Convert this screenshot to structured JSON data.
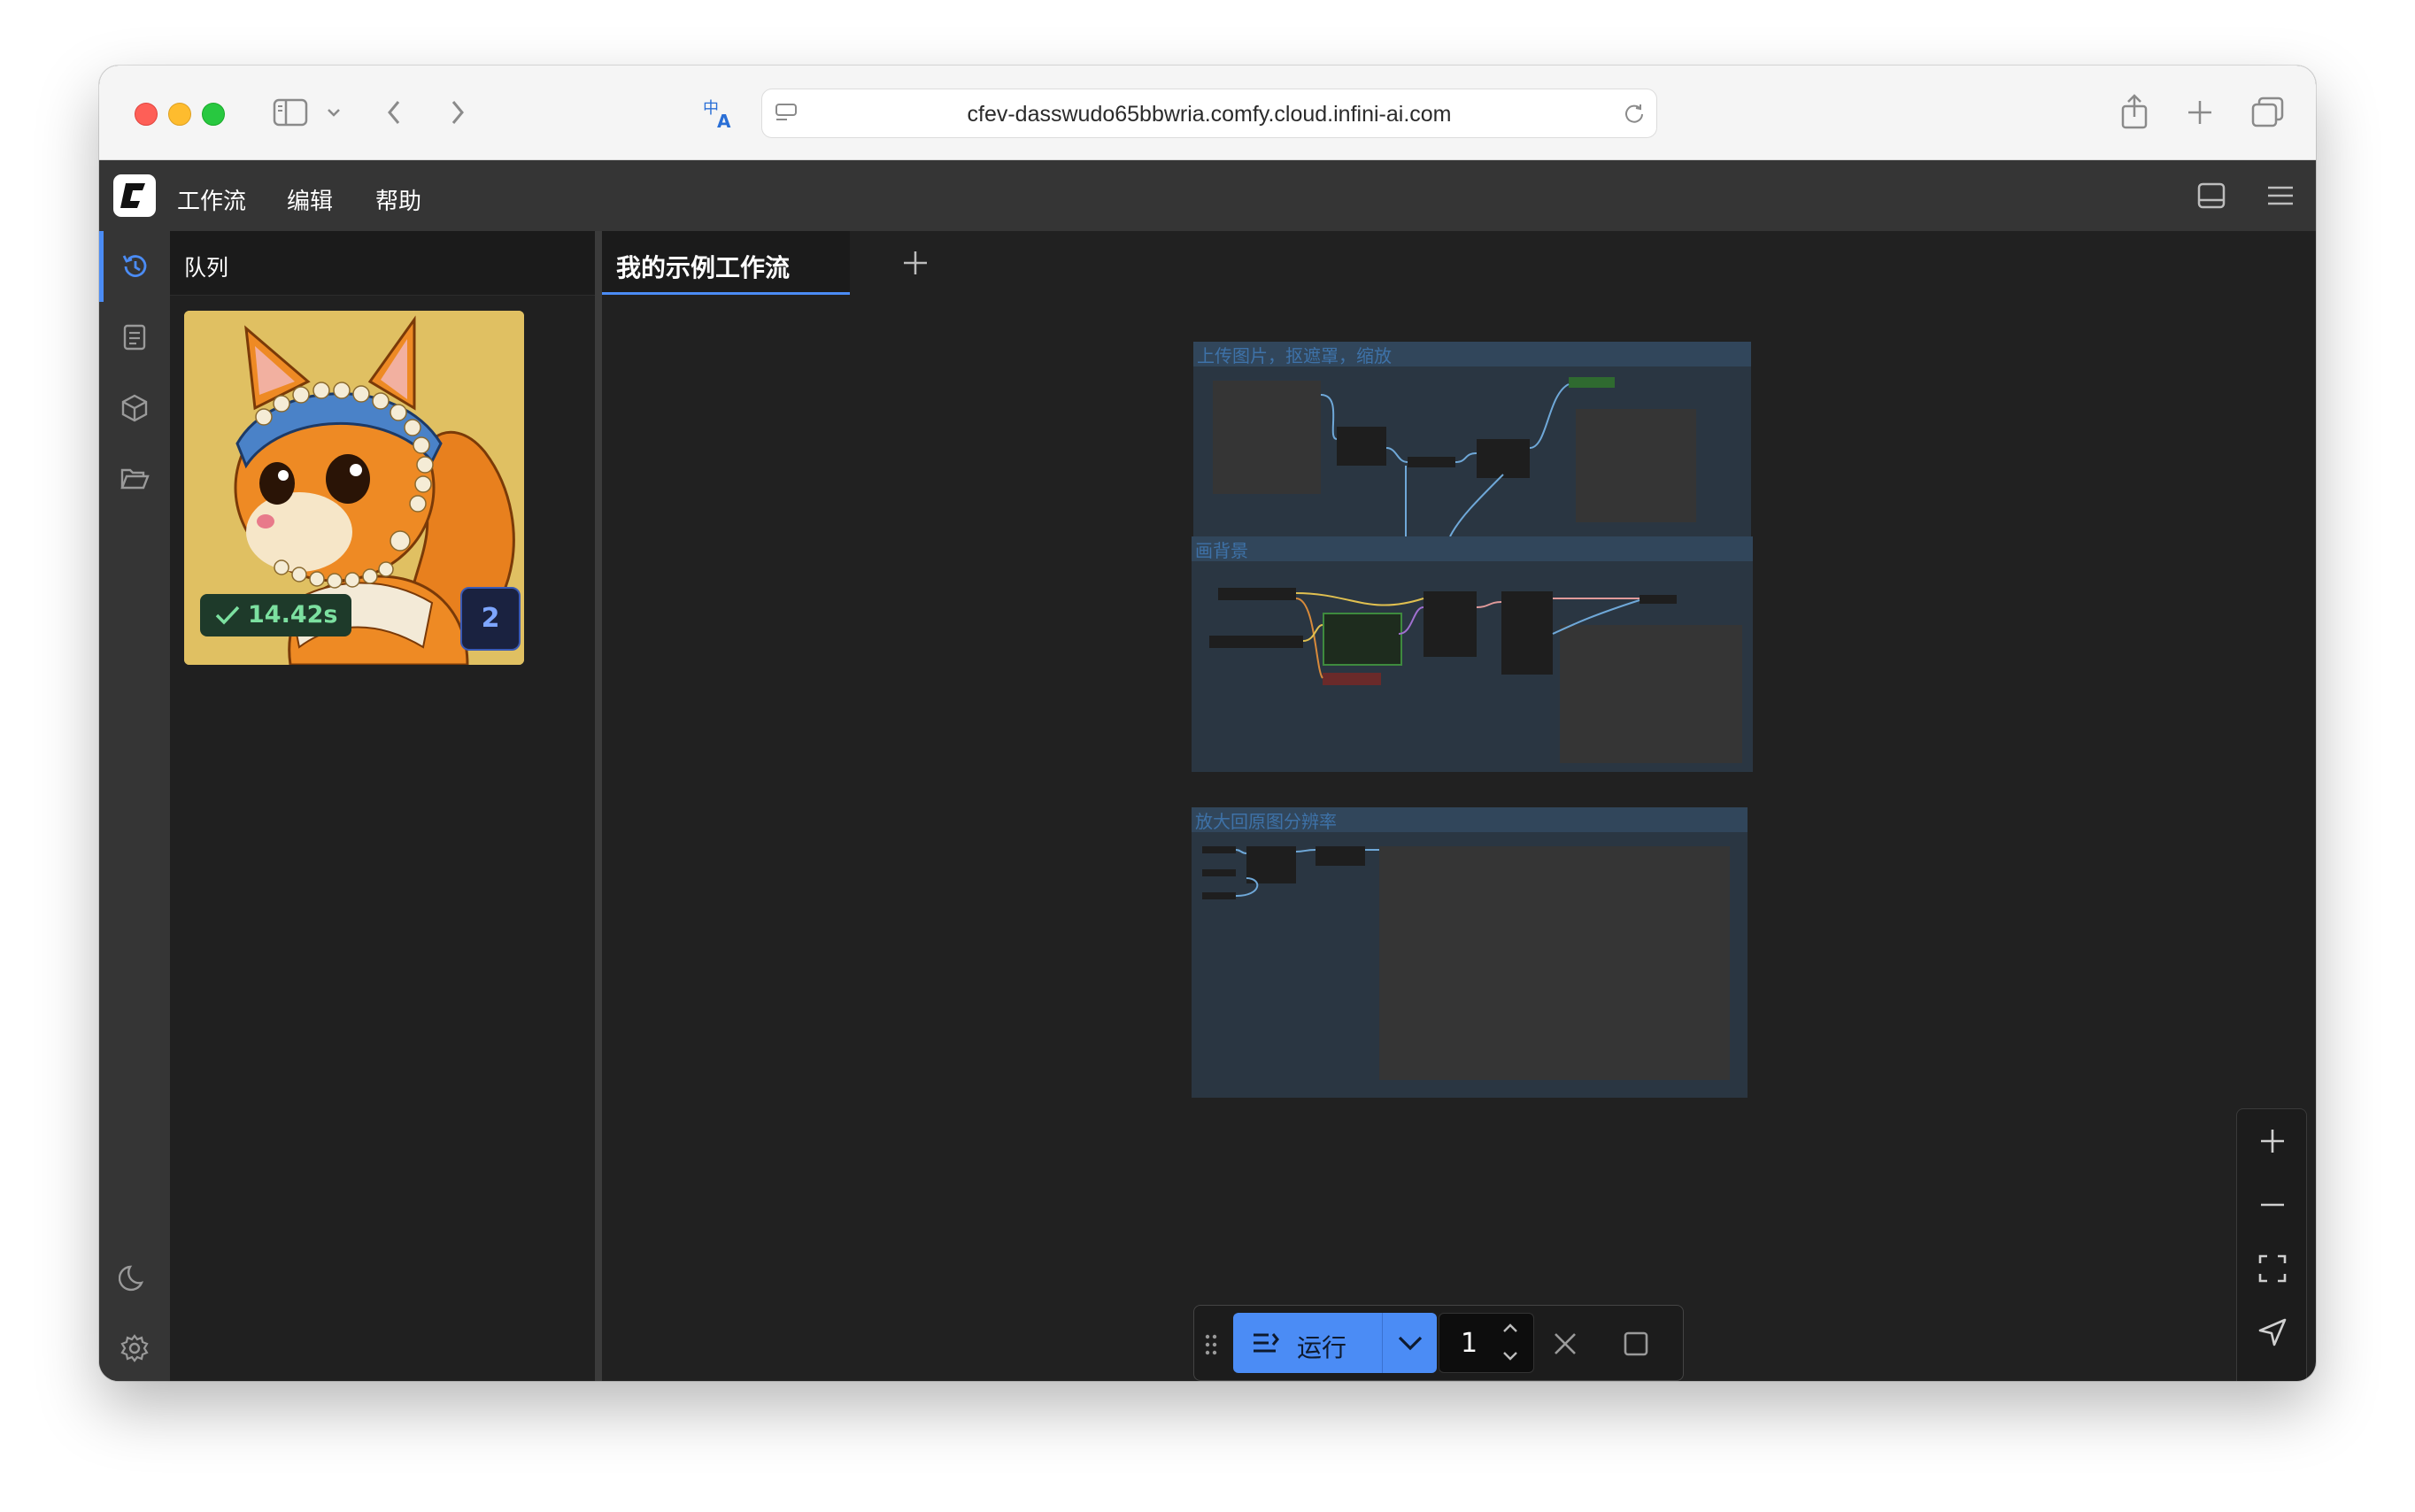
{
  "browser": {
    "url": "cfev-dasswudo65bbwria.comfy.cloud.infini-ai.com"
  },
  "menubar": {
    "items": [
      "工作流",
      "编辑",
      "帮助"
    ]
  },
  "queue": {
    "title": "队列",
    "item": {
      "duration": "14.42s",
      "count": "2"
    }
  },
  "tabs": {
    "active_label": "我的示例工作流"
  },
  "canvas": {
    "groups": [
      {
        "title": "上传图片，抠遮罩，缩放"
      },
      {
        "title": "画背景"
      },
      {
        "title": "放大回原图分辨率"
      }
    ]
  },
  "runbar": {
    "run_label": "运行",
    "batch_count": "1"
  },
  "colors": {
    "accent": "#4b8cf5",
    "background": "#212121",
    "panel": "#353535",
    "success": "#7ce0a0"
  }
}
